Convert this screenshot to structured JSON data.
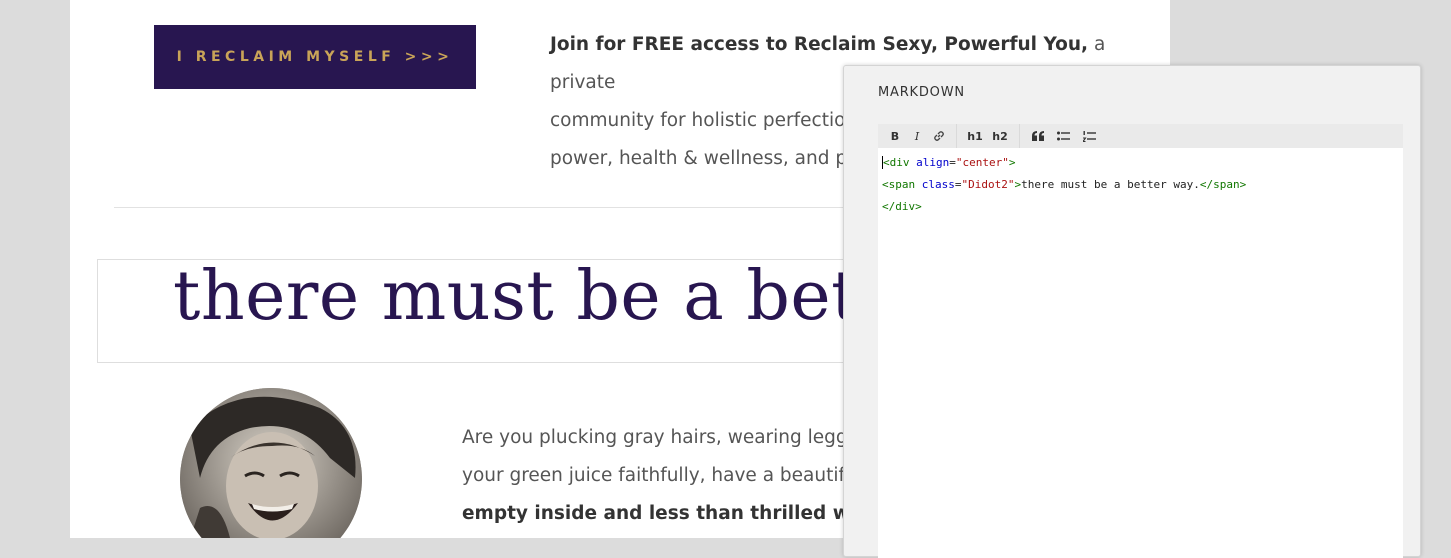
{
  "page": {
    "cta_label": "I RECLAIM MYSELF >>>",
    "join_bold": "Join for FREE access to Reclaim Sexy, Powerful You,",
    "join_line1_rest": " a private",
    "join_line2": "community for holistic perfectionists",
    "join_line3": "power, health & wellness, and persor",
    "headline": "there must be a bette",
    "body_line1": "Are you plucking gray hairs, wearing leggings th",
    "body_line2": "your green juice faithfully, have a beautiful hom",
    "body_line3_bold": "empty inside and less than thrilled with your li"
  },
  "editor": {
    "title": "MARKDOWN",
    "toolbar": {
      "bold": "B",
      "italic": "I",
      "link_icon": "link-icon",
      "h1": "h1",
      "h2": "h2",
      "quote_icon": "quote-icon",
      "ul_icon": "bulleted-list-icon",
      "ol_icon": "numbered-list-icon"
    },
    "code": {
      "l1_tag_open": "<div",
      "l1_attr": "align",
      "l1_eq": "=",
      "l1_val": "\"center\"",
      "l1_close": ">",
      "l2_tag_open": "<span",
      "l2_attr": "class",
      "l2_eq": "=",
      "l2_val": "\"Didot2\"",
      "l2_close": ">",
      "l2_text": "there must be a better way.",
      "l2_end": "</span>",
      "l3": "</div>"
    }
  },
  "colors": {
    "brand_purple": "#281650",
    "cta_gold": "#c9a458",
    "code_tag": "#117700",
    "code_attr": "#0000cc",
    "code_string": "#aa1111"
  }
}
